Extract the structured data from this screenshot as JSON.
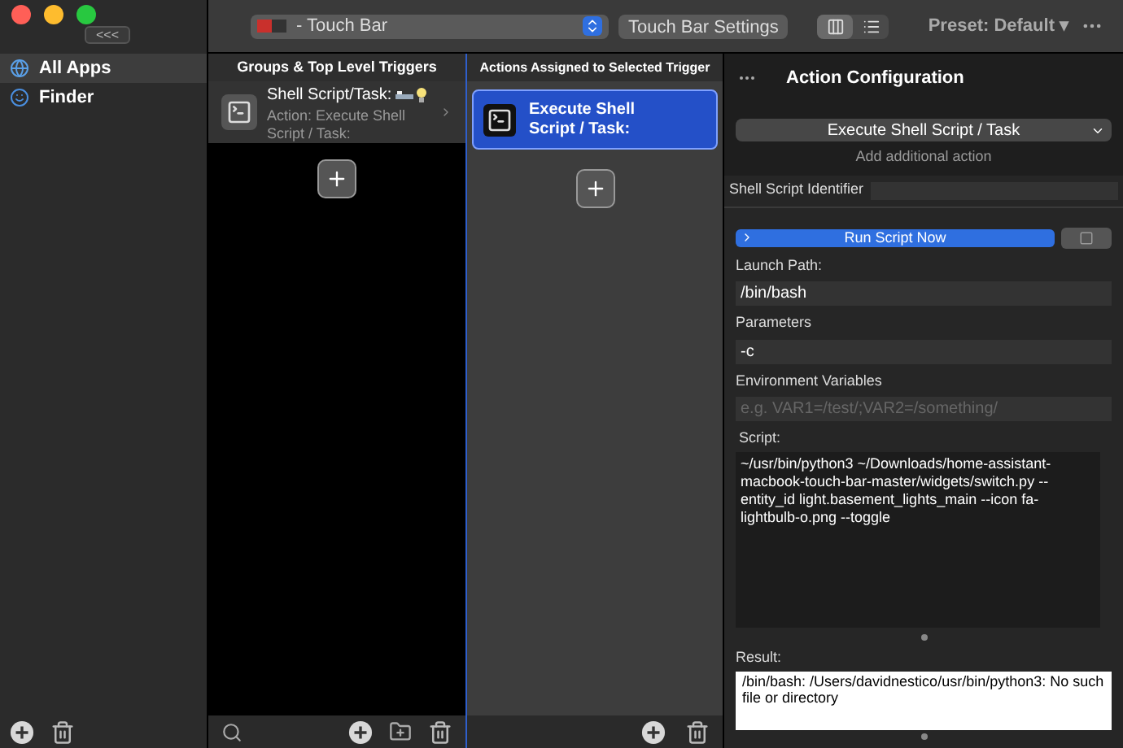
{
  "sidebar": {
    "collapse_button": "<<<",
    "items": [
      {
        "label": "All Apps",
        "selected": true,
        "kind": "globe"
      },
      {
        "label": "Finder",
        "selected": false,
        "kind": "finder"
      }
    ]
  },
  "toolbar": {
    "device": "- Touch Bar",
    "settings_button": "Touch Bar Settings",
    "view_modes": [
      {
        "kind": "columns",
        "selected": true
      },
      {
        "kind": "list",
        "selected": false
      }
    ],
    "preset": "Preset: Default ▾"
  },
  "triggers": {
    "header": "Groups & Top Level Triggers",
    "items": [
      {
        "title": "Shell Script/Task:",
        "subtitle": "Action: Execute Shell Script / Task:",
        "selected": true
      }
    ]
  },
  "actions": {
    "header": "Actions Assigned to Selected Trigger",
    "items": [
      {
        "title": "Execute Shell Script / Task:",
        "selected": true
      }
    ]
  },
  "config": {
    "title": "Action Configuration",
    "action_select": "Execute Shell Script / Task",
    "add_action": "Add additional action",
    "identifier_label": "Shell Script Identifier",
    "run_button": "Run Script Now",
    "fields": [
      {
        "label": "Launch Path:",
        "value": "/bin/bash"
      },
      {
        "label": "Parameters",
        "value": "-c"
      },
      {
        "label": "Environment Variables",
        "placeholder": "e.g. VAR1=/test/;VAR2=/something/"
      }
    ],
    "script_label": "Script:",
    "script": "~/usr/bin/python3 ~/Downloads/home-assistant-macbook-touch-bar-master/widgets/switch.py --entity_id light.basement_lights_main --icon fa-lightbulb-o.png --toggle",
    "result_label": "Result:",
    "result": "/bin/bash: /Users/davidnestico/usr/bin/python3: No such file or directory"
  }
}
